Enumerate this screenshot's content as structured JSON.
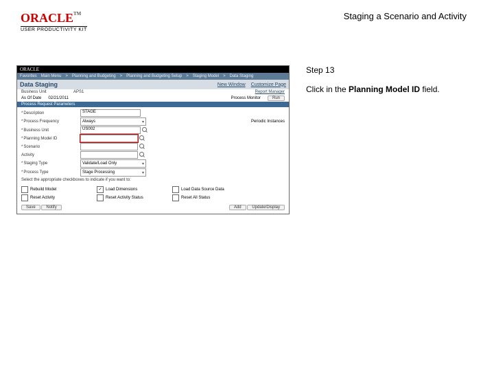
{
  "header": {
    "brand": "ORACLE",
    "tm": "TM",
    "subbrand": "USER PRODUCTIVITY KIT",
    "title": "Staging a Scenario and Activity"
  },
  "instruction": {
    "step": "Step 13",
    "pre": "Click in the ",
    "bold": "Planning Model ID",
    "post": " field."
  },
  "shot": {
    "brand": "ORACLE",
    "nav": [
      "Favorites",
      "Main Menu",
      "Planning and Budgeting",
      "Planning and Budgeting Setup",
      "Staging Model",
      "Data Staging"
    ],
    "subnav": {
      "title": "Data Staging",
      "newwin": "New Window",
      "custpage": "Customize Page",
      "help": ""
    },
    "unit": {
      "lab": "Business Unit",
      "val": "APS1",
      "link": "Report Manager"
    },
    "asof": {
      "lab": "As Of Date",
      "val": "02/21/2011",
      "link": "Process Monitor"
    },
    "run_btn": "Run",
    "section": "Process Request Parameters",
    "fields": {
      "desc": {
        "lab": "Description",
        "val": "STAGE"
      },
      "freq": {
        "lab": "Process Frequency",
        "val": "Always"
      },
      "bu": {
        "lab": "Business Unit",
        "val": "US002"
      },
      "model": {
        "lab": "Planning Model ID",
        "val": ""
      },
      "scen": {
        "lab": "Scenario",
        "val": ""
      },
      "act": {
        "lab": "Activity",
        "val": ""
      },
      "stype": {
        "lab": "Staging Type",
        "val": "Validate/Load Only"
      },
      "ptype": {
        "lab": "Process Type",
        "val": "Stage Processing"
      }
    },
    "checks_label": "Select the appropriate checkboxes to indicate if you want to:",
    "checks": [
      {
        "t": "Rebuild Model",
        "c": false
      },
      {
        "t": "Load Dimensions",
        "c": true
      },
      {
        "t": "Load Data Source Data",
        "c": false
      },
      {
        "t": "Reset Activity",
        "c": false
      },
      {
        "t": "Reset Activity Status",
        "c": false
      },
      {
        "t": "Reset All Status",
        "c": false
      }
    ],
    "foot": {
      "save": "Save",
      "notify": "Notify",
      "add": "Add",
      "update": "Update/Display"
    }
  }
}
